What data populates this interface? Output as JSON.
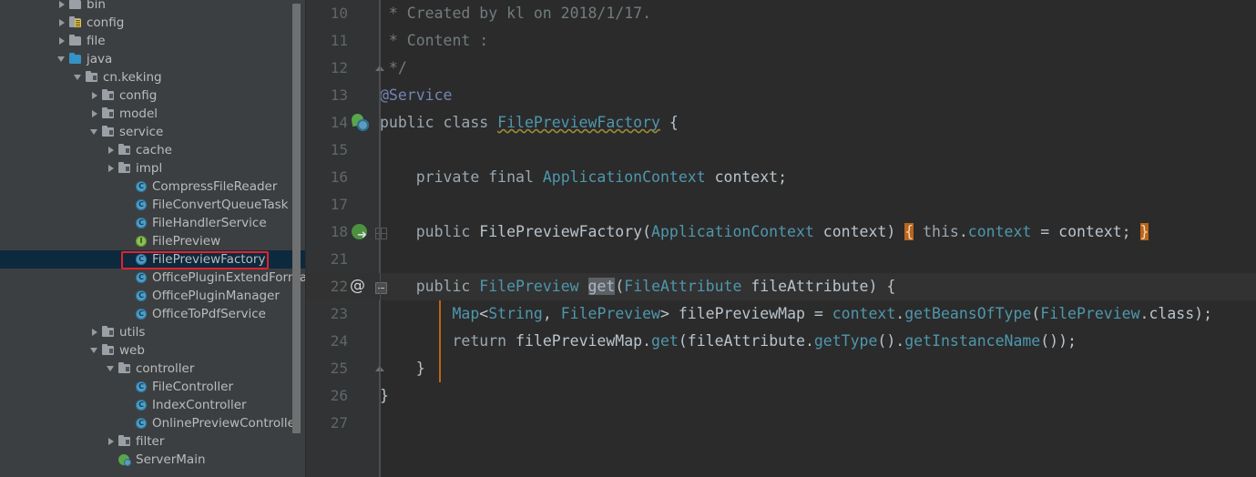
{
  "app": {
    "theme_bg": "#3c3f41",
    "editor_bg": "#2b2b2b",
    "gutter_bg": "#313335",
    "selection_color": "#0d293e",
    "annotation_box_color": "#e8202a",
    "brace_highlight_color": "#b9651b"
  },
  "sidebar": {
    "name": "project-tree",
    "scrollbar": {
      "name": "sidebar-scrollbar"
    },
    "items": [
      {
        "label": "bin",
        "depth": 1,
        "arrow": "right",
        "icon": "folder-icon",
        "selected": false
      },
      {
        "label": "config",
        "depth": 1,
        "arrow": "right",
        "icon": "resource-folder-icon",
        "selected": false
      },
      {
        "label": "file",
        "depth": 1,
        "arrow": "right",
        "icon": "folder-icon",
        "selected": false
      },
      {
        "label": "java",
        "depth": 1,
        "arrow": "down",
        "icon": "source-folder-icon",
        "selected": false
      },
      {
        "label": "cn.keking",
        "depth": 2,
        "arrow": "down",
        "icon": "package-icon",
        "selected": false
      },
      {
        "label": "config",
        "depth": 3,
        "arrow": "right",
        "icon": "package-icon",
        "selected": false
      },
      {
        "label": "model",
        "depth": 3,
        "arrow": "right",
        "icon": "package-icon",
        "selected": false
      },
      {
        "label": "service",
        "depth": 3,
        "arrow": "down",
        "icon": "package-icon",
        "selected": false
      },
      {
        "label": "cache",
        "depth": 4,
        "arrow": "right",
        "icon": "package-icon",
        "selected": false
      },
      {
        "label": "impl",
        "depth": 4,
        "arrow": "right",
        "icon": "package-icon",
        "selected": false
      },
      {
        "label": "CompressFileReader",
        "depth": 5,
        "arrow": "none",
        "icon": "java-class-icon",
        "selected": false
      },
      {
        "label": "FileConvertQueueTask",
        "depth": 5,
        "arrow": "none",
        "icon": "java-class-icon",
        "selected": false
      },
      {
        "label": "FileHandlerService",
        "depth": 5,
        "arrow": "none",
        "icon": "java-class-icon",
        "selected": false
      },
      {
        "label": "FilePreview",
        "depth": 5,
        "arrow": "none",
        "icon": "java-interface-icon",
        "selected": false
      },
      {
        "label": "FilePreviewFactory",
        "depth": 5,
        "arrow": "none",
        "icon": "java-class-icon",
        "selected": true
      },
      {
        "label": "OfficePluginExtendFormatReg",
        "depth": 5,
        "arrow": "none",
        "icon": "java-class-icon",
        "selected": false
      },
      {
        "label": "OfficePluginManager",
        "depth": 5,
        "arrow": "none",
        "icon": "java-class-icon",
        "selected": false
      },
      {
        "label": "OfficeToPdfService",
        "depth": 5,
        "arrow": "none",
        "icon": "java-class-icon",
        "selected": false
      },
      {
        "label": "utils",
        "depth": 3,
        "arrow": "right",
        "icon": "package-icon",
        "selected": false
      },
      {
        "label": "web",
        "depth": 3,
        "arrow": "down",
        "icon": "package-icon",
        "selected": false
      },
      {
        "label": "controller",
        "depth": 4,
        "arrow": "down",
        "icon": "package-icon",
        "selected": false
      },
      {
        "label": "FileController",
        "depth": 5,
        "arrow": "none",
        "icon": "java-class-icon",
        "selected": false
      },
      {
        "label": "IndexController",
        "depth": 5,
        "arrow": "none",
        "icon": "java-class-icon",
        "selected": false
      },
      {
        "label": "OnlinePreviewController",
        "depth": 5,
        "arrow": "none",
        "icon": "java-class-icon",
        "selected": false
      },
      {
        "label": "filter",
        "depth": 4,
        "arrow": "right",
        "icon": "package-icon",
        "selected": false
      },
      {
        "label": "ServerMain",
        "depth": 4,
        "arrow": "none",
        "icon": "spring-main-class-icon",
        "selected": false
      }
    ]
  },
  "editor": {
    "name": "code-editor",
    "file": "FilePreviewFactory",
    "current_line": 22,
    "lines": [
      {
        "num": "10",
        "marker": "",
        "fold": "",
        "text": " * Created by kl on 2018/1/17."
      },
      {
        "num": "11",
        "marker": "",
        "fold": "",
        "text": " * Content :"
      },
      {
        "num": "12",
        "marker": "",
        "fold": "fold-up",
        "text": " */"
      },
      {
        "num": "13",
        "marker": "",
        "fold": "",
        "text": "@Service"
      },
      {
        "num": "14",
        "marker": "spring-bean",
        "fold": "",
        "text": "public class FilePreviewFactory {"
      },
      {
        "num": "15",
        "marker": "",
        "fold": "",
        "text": ""
      },
      {
        "num": "16",
        "marker": "",
        "fold": "",
        "text": "    private final ApplicationContext context;"
      },
      {
        "num": "17",
        "marker": "",
        "fold": "",
        "text": ""
      },
      {
        "num": "18",
        "marker": "spring-dep",
        "fold": "fold-box",
        "text": "    public FilePreviewFactory(ApplicationContext context) { this.context = context; }"
      },
      {
        "num": "21",
        "marker": "",
        "fold": "",
        "text": ""
      },
      {
        "num": "22",
        "marker": "at-sign",
        "fold": "fold-minus",
        "text": "    public FilePreview get(FileAttribute fileAttribute) {"
      },
      {
        "num": "23",
        "marker": "",
        "fold": "",
        "text": "        Map<String, FilePreview> filePreviewMap = context.getBeansOfType(FilePreview.class);"
      },
      {
        "num": "24",
        "marker": "",
        "fold": "",
        "text": "        return filePreviewMap.get(fileAttribute.getType().getInstanceName());"
      },
      {
        "num": "25",
        "marker": "",
        "fold": "fold-up",
        "text": "    }"
      },
      {
        "num": "26",
        "marker": "",
        "fold": "",
        "text": "}"
      },
      {
        "num": "27",
        "marker": "",
        "fold": "",
        "text": ""
      }
    ]
  }
}
